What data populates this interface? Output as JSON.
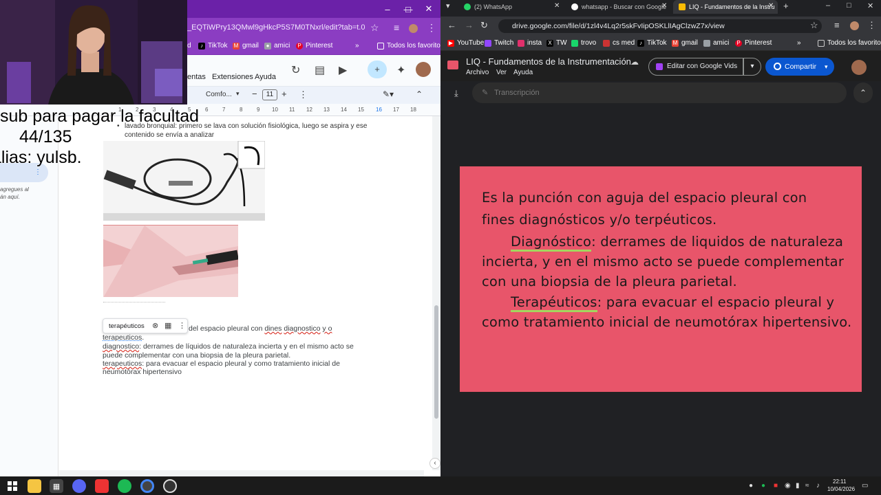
{
  "left_window": {
    "url": "_EQTiWPry13QMwl9gHkcP5S7M0TNxrl/edit?tab=t.0",
    "bookmarks": [
      "d",
      "TikTok",
      "gmail",
      "amici",
      "Pinterest",
      "Todos los favoritos"
    ],
    "menu": [
      "entas",
      "Extensiones",
      "Ayuda"
    ],
    "toolbar": {
      "font": "Comfo...",
      "size": "11"
    },
    "ruler": [
      "1",
      "2",
      "3",
      "4",
      "5",
      "6",
      "7",
      "8",
      "9",
      "10",
      "11",
      "12",
      "13",
      "14",
      "15",
      "16",
      "17",
      "18"
    ],
    "side_hint_1": "agregues al",
    "side_hint_2": "án aquí.",
    "doc": {
      "bullet_top": "lavado bronquial: primero se lava con solución fisiológica, luego se aspira y ese",
      "bullet_top2": "contenido se envía a analizar",
      "chip_label": "terapéuticos",
      "p1_tail": "del espacio pleural con",
      "p1_err1": "dines",
      "p1_err2": "diagnostico",
      "p1_err3": "y o",
      "p2_word": "terapeuticos",
      "p2_end": ".",
      "p3_word": "diagnostico",
      "p3_rest": ": derrames de líquidos de naturaleza incierta y en el mismo acto se",
      "p4": "puede complementar con una biopsia de la pleura parietal.",
      "p5_word": "terapeuticos",
      "p5_rest": ": para evacuar el espacio pleural y como tratamiento inicial de",
      "p6": "neumotórax hipertensivo"
    }
  },
  "overlay": {
    "line1": "sub para pagar la facultad",
    "line2": "44/135",
    "line3": "alias: yulsb."
  },
  "right_window": {
    "tabs": [
      {
        "label": "(2) WhatsApp"
      },
      {
        "label": "whatsapp - Buscar con Google"
      },
      {
        "label": "LIQ - Fundamentos de la Instru"
      }
    ],
    "url": "drive.google.com/file/d/1zl4v4Lq2r5skFvIipOSKLlIAgClzwZ7x/view",
    "bookmarks": [
      "YouTube",
      "Twitch",
      "insta",
      "TW",
      "trovo",
      "cs med",
      "TikTok",
      "gmail",
      "amici",
      "Pinterest",
      "Todos los favoritos"
    ],
    "file_title": "LIQ - Fundamentos de la Instrumentación...",
    "file_menu": [
      "Archivo",
      "Ver",
      "Ayuda"
    ],
    "edit_btn": "Editar con Google Vids",
    "share_btn": "Compartir",
    "transcript": "Transcripción",
    "slide": {
      "l1": "Es la punción con aguja del espacio pleural con",
      "l2": "fines diagnósticos y/o terpéuticos.",
      "l3a": "Diagnóstico",
      "l3b": ": derrames de liquidos de naturaleza",
      "l4": "incierta, y en el mismo acto se puede complementar",
      "l5": "con una biopsia de la pleura parietal.",
      "l6a": "Terapéuticos",
      "l6b": ": para evacuar el espacio pleural y",
      "l7": "como tratamiento inicial de neumotórax hipertensivo."
    }
  },
  "taskbar": {
    "time": "22:11",
    "date": "10/04/2026"
  }
}
